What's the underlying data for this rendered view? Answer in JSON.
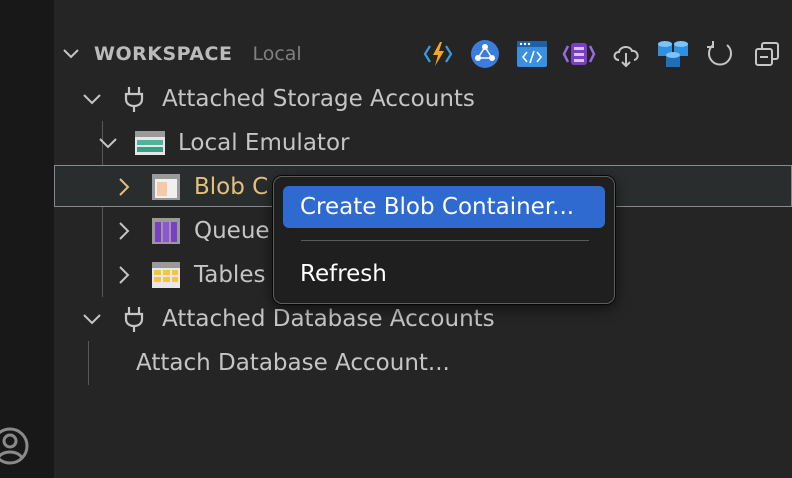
{
  "section": {
    "title": "WORKSPACE",
    "subtitle": "Local"
  },
  "toolbar": {
    "buttons": [
      {
        "name": "azure-functions-icon",
        "color": "#f5a623"
      },
      {
        "name": "network-graph-icon",
        "color": "#3b7ddd"
      },
      {
        "name": "web-code-window-icon",
        "color": "#3a8fde"
      },
      {
        "name": "logic-app-icon",
        "color": "#8a4fd6"
      },
      {
        "name": "cloud-download-icon",
        "color": "#c5c5c5"
      },
      {
        "name": "databases-icon",
        "color": "#2f8fe0"
      },
      {
        "name": "refresh-icon",
        "color": "#c5c5c5"
      },
      {
        "name": "collapse-all-icon",
        "color": "#c5c5c5"
      }
    ]
  },
  "tree": {
    "attached_storage": "Attached Storage Accounts",
    "local_emulator": "Local Emulator",
    "blob_containers": "Blob C",
    "queues": "Queue",
    "tables": "Tables",
    "attached_database": "Attached Database Accounts",
    "attach_database": "Attach Database Account..."
  },
  "context_menu": {
    "items": [
      {
        "label": "Create Blob Container...",
        "highlighted": true
      },
      {
        "label": "Refresh",
        "highlighted": false
      }
    ]
  },
  "colors": {
    "selected_label": "#e5c07b",
    "menu_highlight": "#2f6ad1"
  }
}
